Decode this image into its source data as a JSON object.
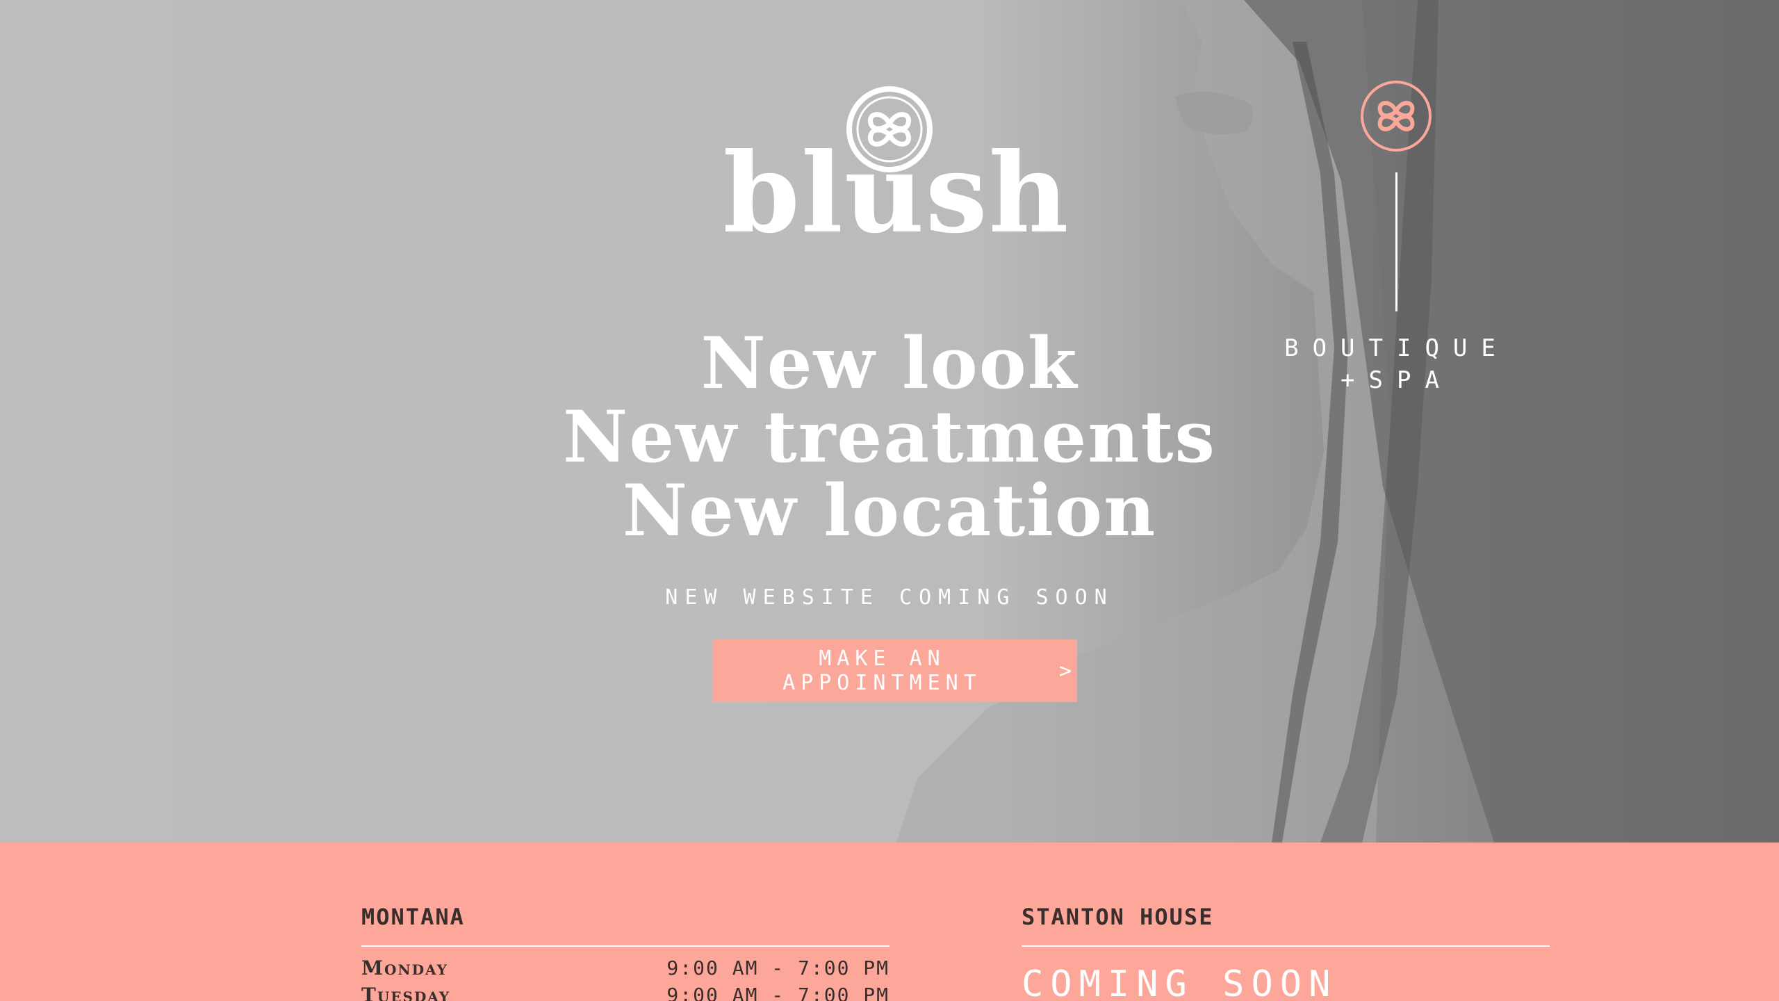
{
  "hero": {
    "brand": {
      "name": "blush",
      "icon": "clover-heart-logo"
    },
    "side": {
      "icon": "clover-heart-logo",
      "line1": "BOUTIQUE",
      "line2": "+SPA"
    },
    "headline": [
      "New look",
      "New treatments",
      "New location"
    ],
    "subhead": "NEW WEBSITE COMING SOON",
    "cta": {
      "label": "MAKE AN APPOINTMENT",
      "icon": "chevron-right-icon",
      "glyph": ">"
    }
  },
  "locations": [
    {
      "name": "MONTANA",
      "hours": [
        {
          "day": "Monday",
          "time": "9:00 AM - 7:00 PM"
        },
        {
          "day": "Tuesday",
          "time": "9:00 AM - 7:00 PM"
        }
      ]
    },
    {
      "name": "STANTON HOUSE",
      "status": "COMING SOON"
    }
  ],
  "colors": {
    "accent": "#fba79a",
    "footer_bg": "#fda79b",
    "text_dark": "#3a2e2c",
    "white": "#ffffff"
  }
}
